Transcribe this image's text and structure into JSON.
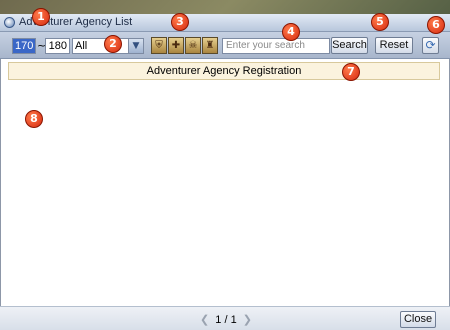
{
  "window": {
    "title": "Adventurer Agency List"
  },
  "toolbar": {
    "level_min": "170",
    "level_sep": "~",
    "level_max": "180",
    "job_select": "All",
    "class_icons": [
      "shield-emblem-icon",
      "cross-emblem-icon",
      "mask-emblem-icon",
      "figure-emblem-icon"
    ],
    "search_placeholder": "Enter your search",
    "search_label": "Search",
    "reset_label": "Reset",
    "refresh_glyph": "⟳"
  },
  "registration": {
    "label": "Adventurer Agency Registration"
  },
  "footer": {
    "page": "1 / 1",
    "prev": "❮",
    "next": "❯",
    "close_label": "Close"
  },
  "markers": [
    "1",
    "2",
    "3",
    "4",
    "5",
    "6",
    "7",
    "8"
  ],
  "colors": {
    "marker": "#d62a10",
    "selection": "#3a67c7",
    "toolbar": "#b8c7dc",
    "registration_bg": "#fbf3de"
  }
}
